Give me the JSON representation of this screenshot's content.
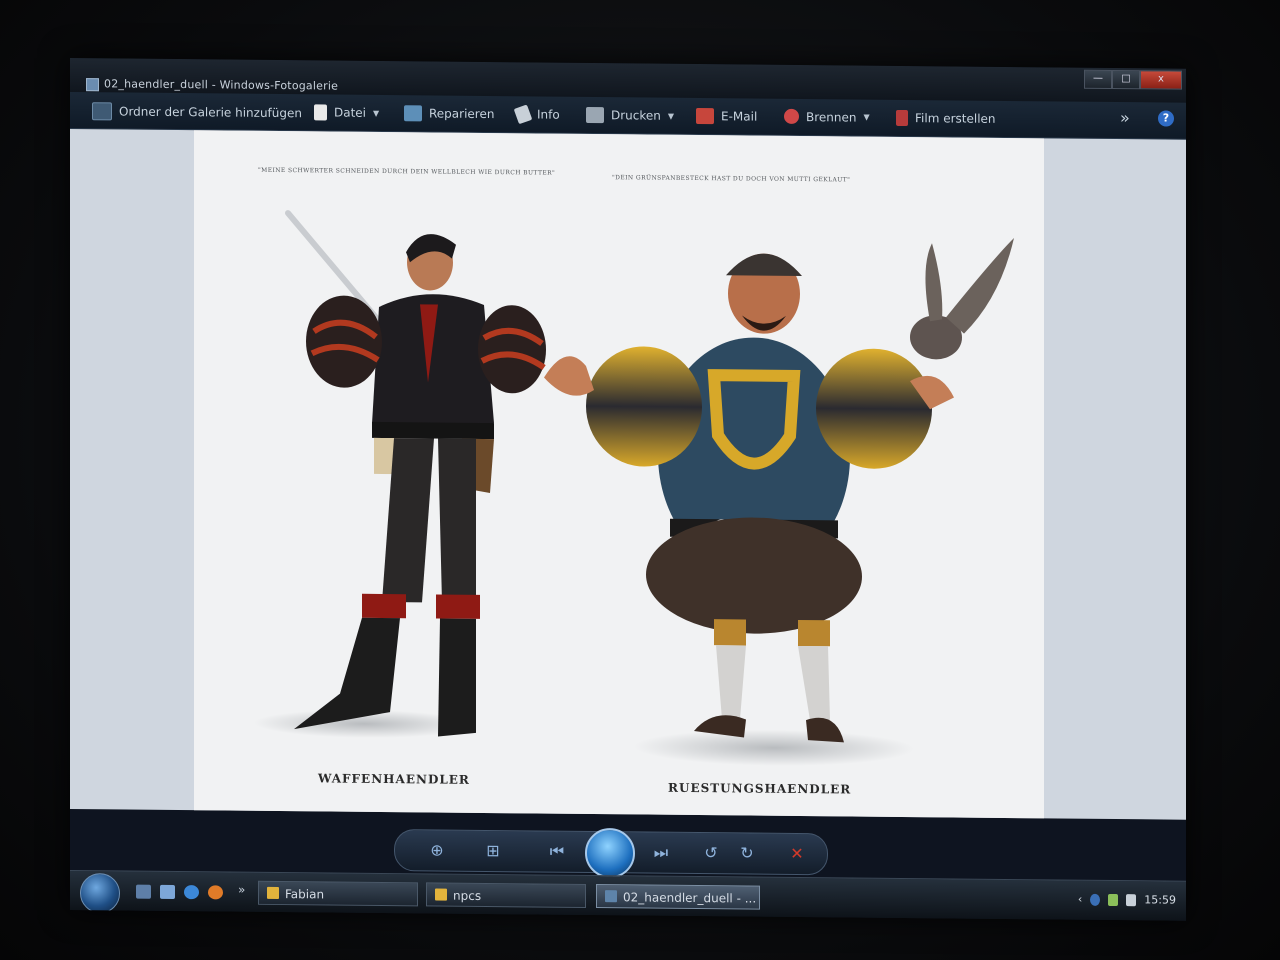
{
  "window": {
    "title": "02_haendler_duell - Windows-Fotogalerie",
    "buttons": {
      "minimize": "—",
      "maximize": "□",
      "close": "x"
    }
  },
  "toolbar": {
    "add_folder": "Ordner der Galerie hinzufügen",
    "file": "Datei",
    "repair": "Reparieren",
    "info": "Info",
    "print": "Drucken",
    "email": "E-Mail",
    "burn": "Brennen",
    "movie": "Film erstellen",
    "overflow": "»",
    "help": "?"
  },
  "artwork": {
    "quote_left": "\"MEINE SCHWERTER SCHNEIDEN DURCH DEIN WELLBLECH WIE DURCH BUTTER\"",
    "quote_right": "\"DEIN GRÜNSPANBESTECK HAST DU DOCH VON MUTTI GEKLAUT\"",
    "caption_left": "WAFFENHAENDLER",
    "caption_right": "RUESTUNGSHAENDLER"
  },
  "taskbar": {
    "quicklaunch_overflow": "»",
    "tasks": [
      {
        "label": "Fabian"
      },
      {
        "label": "npcs"
      },
      {
        "label": "02_haendler_duell - ..."
      }
    ],
    "tray_overflow": "‹",
    "clock": "15:59"
  },
  "colors": {
    "toolbar_bg": "#15212f",
    "taskbar_bg": "#1a222c",
    "canvas_bg": "#f1f2f3"
  }
}
